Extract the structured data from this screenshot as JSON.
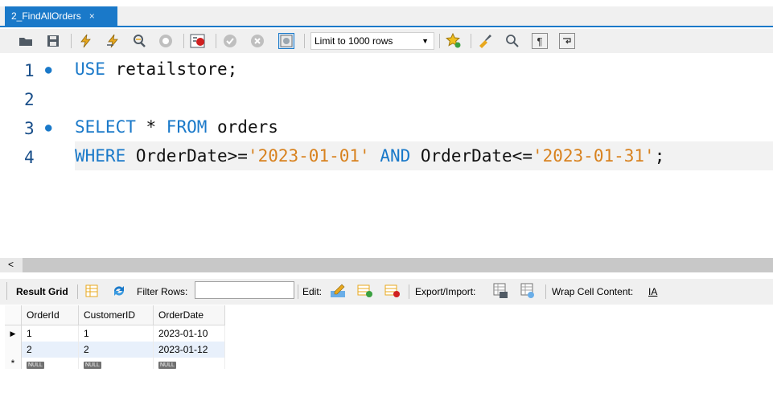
{
  "tab": {
    "title": "2_FindAllOrders",
    "close": "×"
  },
  "toolbar": {
    "limit_label": "Limit to 1000 rows"
  },
  "editor": {
    "lines": [
      {
        "number": "1",
        "marker": "●"
      },
      {
        "number": "2",
        "marker": ""
      },
      {
        "number": "3",
        "marker": "●"
      },
      {
        "number": "4",
        "marker": ""
      }
    ],
    "line1": {
      "kw": "USE",
      "rest": " retailstore;"
    },
    "line3": {
      "kw1": "SELECT",
      "mid": " * ",
      "kw2": "FROM",
      "rest": " orders"
    },
    "line4": {
      "kw1": "WHERE",
      "a": " OrderDate>=",
      "s1": "'2023-01-01'",
      "b": " ",
      "kw2": "AND",
      "c": " OrderDate<=",
      "s2": "'2023-01-31'",
      "d": ";"
    }
  },
  "results": {
    "result_grid_label": "Result Grid",
    "filter_label": "Filter Rows:",
    "filter_value": "",
    "edit_label": "Edit:",
    "export_label": "Export/Import:",
    "wrap_label": "Wrap Cell Content:",
    "wrap_icon_text": "IA",
    "columns": [
      "OrderId",
      "CustomerID",
      "OrderDate"
    ],
    "rows": [
      {
        "indicator": "▶",
        "cells": [
          "1",
          "1",
          "2023-01-10"
        ]
      },
      {
        "indicator": "",
        "cells": [
          "2",
          "2",
          "2023-01-12"
        ]
      }
    ],
    "new_row": {
      "indicator": "*",
      "null_text": "NULL"
    }
  },
  "colors": {
    "accent": "#1a79c9",
    "keyword": "#1a79c9",
    "string": "#d8821f",
    "selected_row": "#e8f0fb"
  }
}
